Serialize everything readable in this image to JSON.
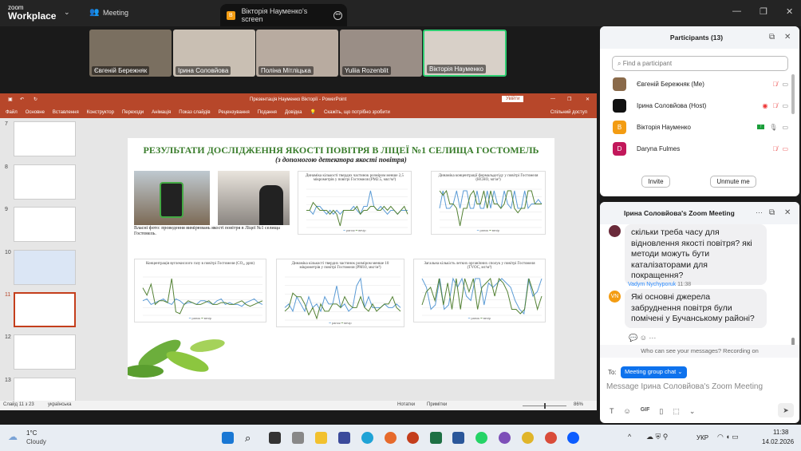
{
  "zoom": {
    "logo_small": "zoom",
    "logo_big": "Workplace",
    "meeting_label": "Meeting",
    "share_tab": "Вікторія Науменко's screen",
    "share_badge": "B"
  },
  "videos": [
    {
      "name": "Євгеній Бережняк"
    },
    {
      "name": "Ірина Соловйова"
    },
    {
      "name": "Поліна Мітліцька"
    },
    {
      "name": "Yuliia Rozenblit"
    },
    {
      "name": "Вікторія Науменко"
    }
  ],
  "ppt": {
    "title": "Презентація Науменко Вікторії - PowerPoint",
    "signin": "Увійти",
    "menu": [
      "Файл",
      "Основне",
      "Вставлення",
      "Конструктор",
      "Переходи",
      "Анімація",
      "Показ слайдів",
      "Рецензування",
      "Подання",
      "Довідка"
    ],
    "tell_me": "Скажіть, що потрібно зробити",
    "share": "Спільний доступ",
    "thumb_numbers": [
      "7",
      "8",
      "9",
      "10",
      "11",
      "12",
      "13"
    ],
    "selected_slide": "11",
    "status": {
      "slide": "Слайд 11 з 23",
      "lang": "українська",
      "notes": "Нотатки",
      "comments": "Примітки",
      "zoom": "86%"
    }
  },
  "slide": {
    "title": "РЕЗУЛЬТАТИ ДОСЛІДЖЕННЯ ЯКОСТІ ПОВІТРЯ В ЛІЦЕЇ №1 СЕЛИЩА ГОСТОМЕЛЬ",
    "subtitle": "(з допомогою детектора якості повітря)",
    "caption": "Власні фото: проведення вимірювань якості повітря в Ліцеї №1 селища Гостомель.",
    "colors": {
      "title": "#3a7d2c",
      "series1": "#5b9bd5",
      "series2": "#548235"
    },
    "legend": [
      "ранок",
      "вечір"
    ],
    "charts": [
      {
        "title": "Динаміка кількості твердих частинок розміром менше 2,5 мікрометрів у повітрі Гостомеля (PM2.5, мкг/м³)",
        "s1": [
          10,
          10,
          9,
          11,
          11,
          10,
          9,
          10,
          9,
          10,
          9,
          10,
          10,
          10,
          11,
          10,
          9,
          11,
          11,
          15,
          11,
          10,
          11,
          10,
          9,
          10,
          10,
          9,
          10,
          10,
          10
        ],
        "s2": [
          10,
          10,
          12,
          11,
          10,
          10,
          10,
          9,
          10,
          9,
          6,
          10,
          10,
          10,
          10,
          11,
          9,
          10,
          10,
          11,
          11,
          10,
          10,
          11,
          10,
          11,
          10,
          9,
          10,
          11,
          9
        ]
      },
      {
        "title": "Динаміка концентрації формальдегіду у повітрі Гостомеля (HCHO, мг/м³)",
        "s1": [
          12,
          16,
          12,
          12,
          13,
          16,
          12,
          16,
          16,
          12,
          12,
          16,
          12,
          12,
          16,
          12,
          16,
          13,
          12,
          16,
          13,
          12,
          16,
          12,
          12,
          16,
          12,
          13,
          13,
          14,
          13
        ],
        "s2": [
          16,
          15,
          16,
          13,
          13,
          12,
          8,
          12,
          12,
          15,
          16,
          13,
          13,
          16,
          12,
          16,
          13,
          13,
          12,
          13,
          16,
          16,
          12,
          11,
          12,
          12,
          16,
          16,
          13,
          13,
          13
        ]
      },
      {
        "title": "Концентрація вуглекислого газу в повітрі Гостомеля (CO₂, ppm)",
        "s1": [
          443,
          444,
          441,
          442,
          443,
          444,
          442,
          441,
          444,
          443,
          441,
          442,
          442,
          441,
          443,
          443,
          442,
          441,
          443,
          444,
          441,
          442,
          441,
          441,
          440,
          442,
          443,
          444,
          442,
          441
        ],
        "s2": [
          450,
          446,
          452,
          441,
          443,
          443,
          442,
          455,
          437,
          436,
          441,
          443,
          442,
          441,
          441,
          442,
          443,
          441,
          441,
          442,
          442,
          441,
          441,
          442,
          443,
          441,
          440,
          441,
          442,
          443
        ]
      },
      {
        "title": "Динаміка кількості твердих частинок розміром менше 10 мікрометрів у повітрі Гостомеля (PM10, мкг/м³)",
        "s1": [
          15,
          16,
          14,
          18,
          16,
          14,
          18,
          15,
          16,
          14,
          18,
          16,
          16,
          21,
          15,
          16,
          14,
          15,
          21,
          23,
          15,
          18,
          15,
          15,
          15,
          16,
          15,
          15,
          16,
          15
        ],
        "s2": [
          14,
          15,
          19,
          18,
          18,
          16,
          13,
          15,
          12,
          16,
          14,
          14,
          16,
          16,
          15,
          18,
          16,
          15,
          15,
          18,
          15,
          14,
          16,
          14,
          15,
          16,
          16,
          18,
          15,
          14
        ]
      },
      {
        "title": "Загальна кількість летких органічних сполук у повітрі Гостомеля (TVOC, мг/м³)",
        "s1": [
          0.072,
          0.062,
          0.037,
          0.042,
          0.072,
          0.037,
          0.042,
          0.072,
          0.062,
          0.072,
          0.052,
          0.047,
          0.072,
          0.072,
          0.042,
          0.067,
          0.062,
          0.067,
          0.072,
          0.067,
          0.062,
          0.047,
          0.037,
          0.032,
          0.072,
          0.052,
          0.057,
          0.072
        ],
        "s2": [
          0.042,
          0.057,
          0.062,
          0.047,
          0.072,
          0.042,
          0.067,
          0.037,
          0.072,
          0.037,
          0.072,
          0.057,
          0.072,
          0.037,
          0.062,
          0.067,
          0.072,
          0.052,
          0.072,
          0.067,
          0.057,
          0.037,
          0.037,
          0.032,
          0.037,
          0.072,
          0.057,
          0.037,
          0.052
        ]
      }
    ]
  },
  "participants": {
    "title": "Participants (13)",
    "search_placeholder": "Find a participant",
    "list": [
      {
        "name": "Євгеній Бережняк (Me)",
        "color": "#8a6a4a",
        "initial": ""
      },
      {
        "name": "Ірина Соловйова (Host)",
        "color": "#111111",
        "initial": ""
      },
      {
        "name": "Вікторія Науменко",
        "color": "#f39c12",
        "initial": "B"
      },
      {
        "name": "Daryna Fulmes",
        "color": "#c2185b",
        "initial": "D"
      }
    ],
    "invite": "Invite",
    "unmute": "Unmute me"
  },
  "chat": {
    "title": "Ірина Соловйова's Zoom Meeting",
    "msg1": "скільки треба часу для відновлення якості повітря? які методи можуть бути каталізаторами для покращення?",
    "sender2": "Vadym Nychyporuk",
    "time2": "11:38",
    "initials2": "VN",
    "msg2": "Які основні джерела забруднення повітря були помічені у Бучанському районі?",
    "notice": "Who can see your messages? Recording on",
    "to_label": "To:",
    "to_value": "Meeting group chat",
    "placeholder": "Message Ірина Соловйова's Zoom Meeting",
    "gif": "GIF"
  },
  "taskbar": {
    "temp": "1°C",
    "weather": "Cloudy",
    "lang": "УКР",
    "time": "11:38",
    "date": "14.02.2026"
  }
}
